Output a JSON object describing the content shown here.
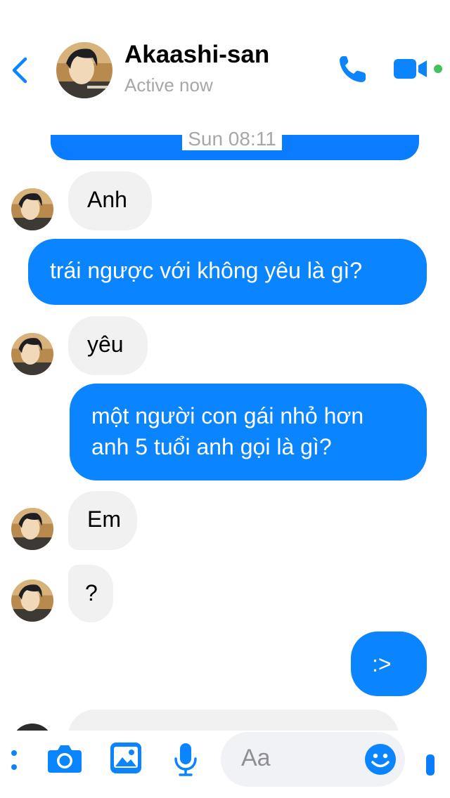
{
  "header": {
    "contact_name": "Akaashi-san",
    "status": "Active now",
    "back_icon": "chevron-left-icon",
    "call_icon": "phone-icon",
    "video_icon": "video-camera-icon"
  },
  "timestamp": "Sun 08:11",
  "messages": [
    {
      "direction": "incoming",
      "text": "Anh"
    },
    {
      "direction": "outgoing",
      "text": "trái ngược với không yêu là gì?"
    },
    {
      "direction": "incoming",
      "text": "yêu"
    },
    {
      "direction": "outgoing",
      "line1": "một người con gái nhỏ hơn",
      "line2": "anh 5 tuổi anh gọi là gì?"
    },
    {
      "direction": "incoming",
      "text": "Em"
    },
    {
      "direction": "incoming",
      "text": "?"
    },
    {
      "direction": "outgoing",
      "text": ":>"
    }
  ],
  "composer": {
    "placeholder": "Aa",
    "icons": [
      "more-icon",
      "camera-icon",
      "image-icon",
      "microphone-icon",
      "emoji-icon",
      "like-icon"
    ]
  },
  "colors": {
    "accent": "#0a84ff",
    "incoming_bubble": "#f1f1f1",
    "status_text": "#a7a7a7",
    "online": "#44c15a"
  }
}
